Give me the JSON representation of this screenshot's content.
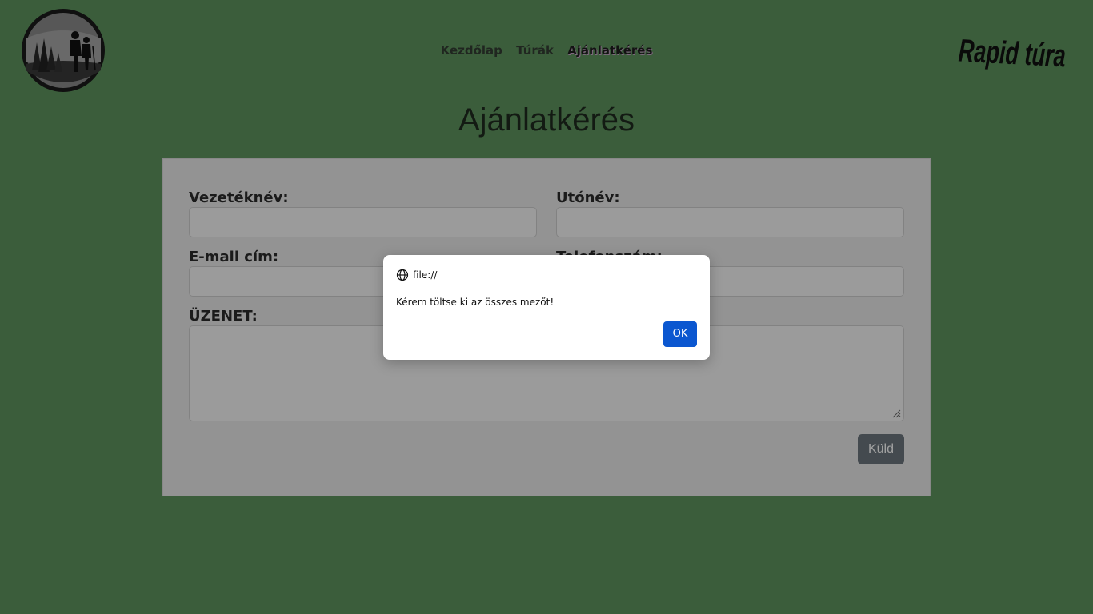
{
  "nav": {
    "items": [
      {
        "label": "Kezdőlap"
      },
      {
        "label": "Túrák"
      },
      {
        "label": "Ajánlatkérés"
      }
    ]
  },
  "brand": {
    "text": "Rapid túra"
  },
  "page": {
    "title": "Ajánlatkérés"
  },
  "form": {
    "last_name_label": "Vezetéknév:",
    "first_name_label": "Utónév:",
    "email_label": "E-mail cím:",
    "phone_label": "Telefonszám:",
    "message_label": "ÜZENET:",
    "submit_label": "Küld"
  },
  "dialog": {
    "origin": "file://",
    "message": "Kérem töltse ki az összes mezőt!",
    "ok_label": "OK"
  },
  "colors": {
    "background": "#5e935e",
    "panel": "#e9e9e9",
    "ok_button": "#0b57d0",
    "submit_button": "#6c757d"
  },
  "icons": {
    "logo": "hikers-logo-icon",
    "origin": "globe-icon"
  }
}
